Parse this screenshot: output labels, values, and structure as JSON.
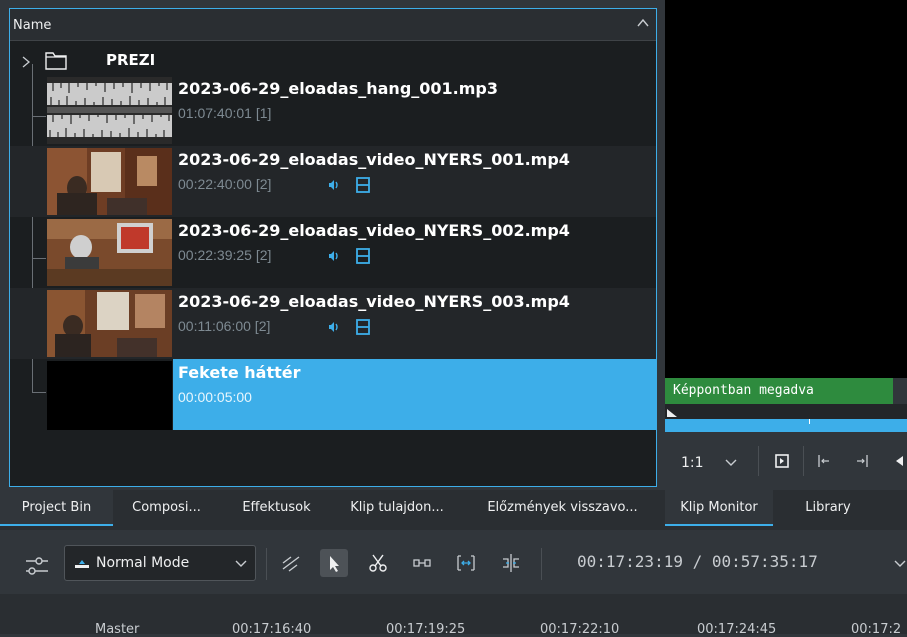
{
  "bin": {
    "header": "Name",
    "folder": "PREZI",
    "clips": [
      {
        "title": "2023-06-29_eloadas_hang_001.mp3",
        "meta": "01:07:40:01 [1]",
        "kind": "audio"
      },
      {
        "title": "2023-06-29_eloadas_video_NYERS_001.mp4",
        "meta": "00:22:40:00 [2]",
        "kind": "video"
      },
      {
        "title": "2023-06-29_eloadas_video_NYERS_002.mp4",
        "meta": "00:22:39:25 [2]",
        "kind": "video"
      },
      {
        "title": "2023-06-29_eloadas_video_NYERS_003.mp4",
        "meta": "00:11:06:00 [2]",
        "kind": "video"
      },
      {
        "title": "Fekete háttér",
        "meta": "00:00:05:00",
        "kind": "color"
      }
    ]
  },
  "monitor": {
    "badge": "Képpontban megadva",
    "zoom": "1:1"
  },
  "tabs": [
    "Project Bin",
    "Composi...",
    "Effektusok",
    "Klip tulajdon...",
    "Előzmények visszavo...",
    "Klip Monitor",
    "Library"
  ],
  "toolbar": {
    "mode": "Normal Mode",
    "timecode": "00:17:23:19 / 00:57:35:17"
  },
  "timeline": {
    "track": "Master",
    "ticks": [
      "00:17:16:40",
      "00:17:19:25",
      "00:17:22:10",
      "00:17:24:45",
      "00:17:2"
    ]
  },
  "colors": {
    "accent": "#3daee9",
    "badge": "#2e8b3e",
    "panel": "#1b1e20"
  }
}
